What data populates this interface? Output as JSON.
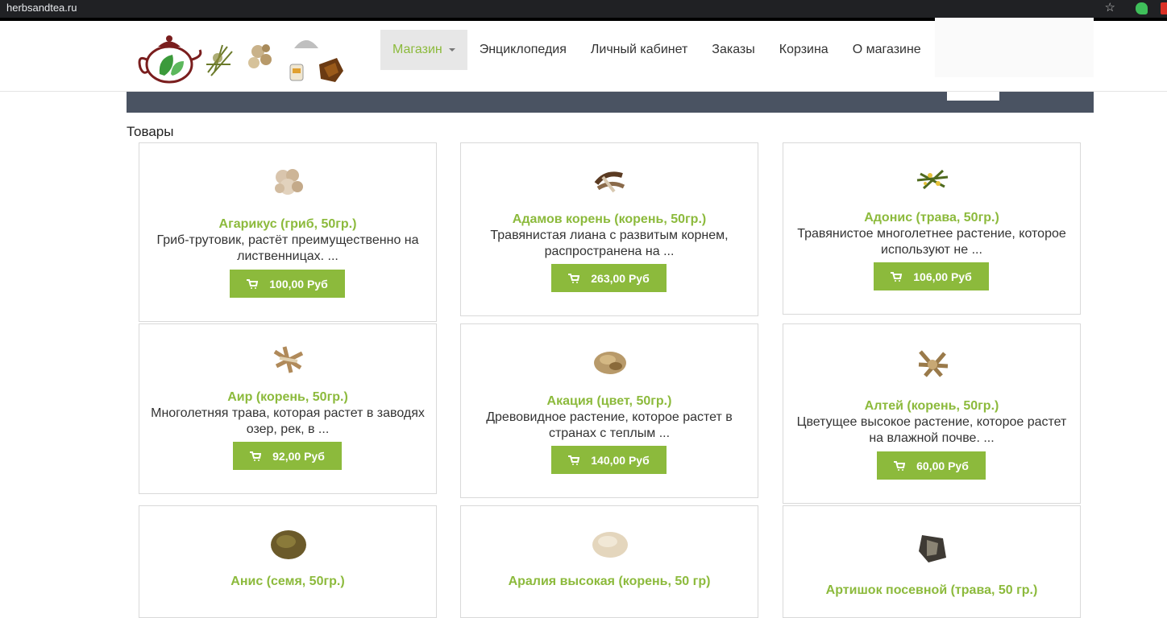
{
  "browser": {
    "url": "herbsandtea.ru"
  },
  "nav": [
    {
      "label": "Магазин",
      "active": true
    },
    {
      "label": "Энциклопедия"
    },
    {
      "label": "Личный кабинет"
    },
    {
      "label": "Заказы"
    },
    {
      "label": "Корзина"
    },
    {
      "label": "О магазине"
    }
  ],
  "section_title": "Товары",
  "accent_color": "#8cba3c",
  "products": [
    {
      "name": "Агарикус (гриб, 50гр.)",
      "desc1": "Гриб-трутовик, растёт преимущественно на",
      "desc2": "лиственницах. ...",
      "price": "100,00 Руб",
      "icon": "agaricus-image"
    },
    {
      "name": "Адамов корень (корень, 50гр.)",
      "desc1": "Травянистая лиана с развитым корнем,",
      "desc2": "распространена на ...",
      "price": "263,00 Руб",
      "icon": "adam-root-image"
    },
    {
      "name": "Адонис (трава, 50гр.)",
      "desc1": "Травянистое многолетнее растение, которое",
      "desc2": "используют не ...",
      "price": "106,00 Руб",
      "icon": "adonis-image"
    },
    {
      "name": "Аир (корень, 50гр.)",
      "desc1": "Многолетняя трава, которая растет в заводях",
      "desc2": "озер, рек, в ...",
      "price": "92,00 Руб",
      "icon": "calamus-image"
    },
    {
      "name": "Акация (цвет, 50гр.)",
      "desc1": "Древовидное растение, которое растет в",
      "desc2": "странах с теплым ...",
      "price": "140,00 Руб",
      "icon": "acacia-image"
    },
    {
      "name": "Алтей (корень, 50гр.)",
      "desc1": "Цветущее высокое растение, которое растет",
      "desc2": "на влажной почве. ...",
      "price": "60,00 Руб",
      "icon": "althaea-image"
    },
    {
      "name": "Анис (семя, 50гр.)",
      "desc1": "",
      "desc2": "",
      "price": "",
      "icon": "anise-image"
    },
    {
      "name": "Аралия высокая (корень, 50 гр)",
      "desc1": "",
      "desc2": "",
      "price": "",
      "icon": "aralia-image"
    },
    {
      "name": "Артишок посевной (трава, 50 гр.)",
      "desc1": "",
      "desc2": "",
      "price": "",
      "icon": "artichoke-image"
    }
  ]
}
